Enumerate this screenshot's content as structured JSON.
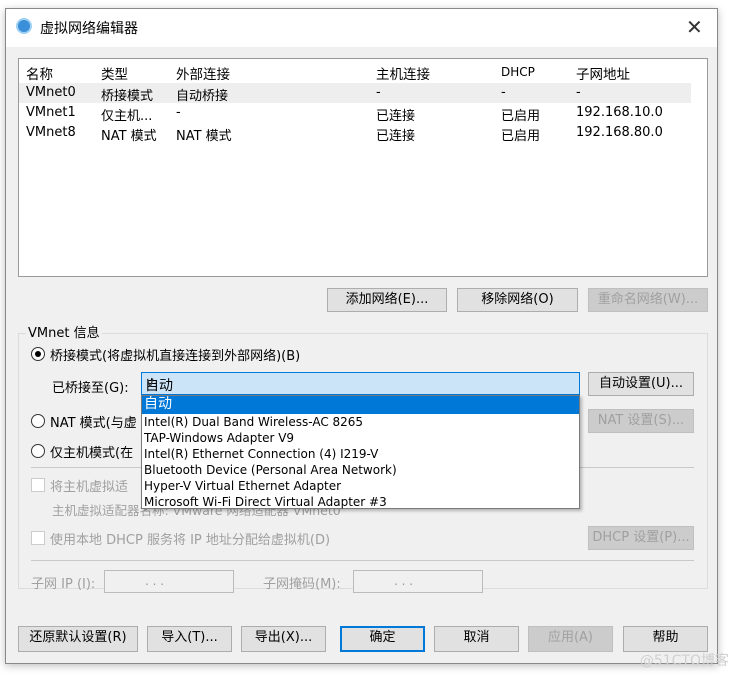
{
  "window": {
    "title": "虚拟网络编辑器",
    "close": "✕"
  },
  "table": {
    "headers": [
      "名称",
      "类型",
      "外部连接",
      "主机连接",
      "DHCP",
      "子网地址"
    ],
    "rows": [
      [
        "VMnet0",
        "桥接模式",
        "自动桥接",
        "-",
        "-",
        "-"
      ],
      [
        "VMnet1",
        "仅主机...",
        "-",
        "已连接",
        "已启用",
        "192.168.10.0"
      ],
      [
        "VMnet8",
        "NAT 模式",
        "NAT 模式",
        "已连接",
        "已启用",
        "192.168.80.0"
      ]
    ]
  },
  "list_buttons": {
    "add": "添加网络(E)...",
    "remove": "移除网络(O)",
    "rename": "重命名网络(W)..."
  },
  "vmnet_info": {
    "label": "VMnet 信息",
    "bridged": "桥接模式(将虚拟机直接连接到外部网络)(B)",
    "bridged_to_label": "已桥接至(G):",
    "bridged_to_value": "自动",
    "auto_settings": "自动设置(U)...",
    "nat": "NAT 模式(与虚",
    "nat_settings": "NAT 设置(S)...",
    "hostonly": "仅主机模式(在",
    "connect_adapter": "将主机虚拟适",
    "adapter_name": "主机虚拟适配器名称: VMware 网络适配器 VMnet0",
    "dhcp": "使用本地 DHCP 服务将 IP 地址分配给虚拟机(D)",
    "dhcp_settings": "DHCP 设置(P)...",
    "subnet_ip_label": "子网 IP (I):",
    "subnet_mask_label": "子网掩码(M):",
    "ip_placeholder": ".    .    ."
  },
  "dropdown_options": [
    "自动",
    "Intel(R) Dual Band Wireless-AC 8265",
    "TAP-Windows Adapter V9",
    "Intel(R) Ethernet Connection (4) I219-V",
    "Bluetooth Device (Personal Area Network)",
    "Hyper-V Virtual Ethernet Adapter",
    "Microsoft Wi-Fi Direct Virtual Adapter #3"
  ],
  "footer": {
    "restore": "还原默认设置(R)",
    "import": "导入(T)...",
    "export": "导出(X)...",
    "ok": "确定",
    "cancel": "取消",
    "apply": "应用(A)",
    "help": "帮助"
  },
  "watermark": "@51CTO博客"
}
